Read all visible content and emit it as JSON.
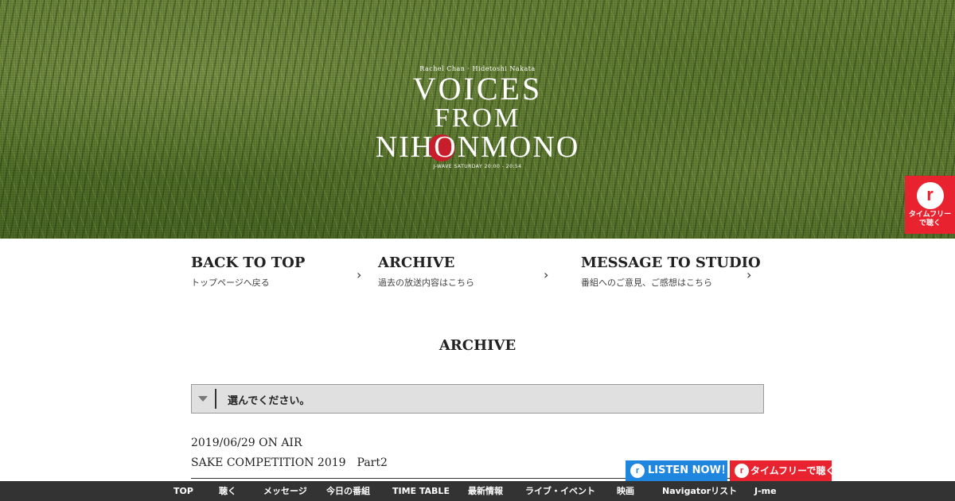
{
  "hero": {
    "logo_top": "Rachel Chan · Hidetoshi Nakata",
    "logo_line1": "VOICES",
    "logo_line2": "FROM",
    "logo_line3": "NIHONMONO",
    "logo_sub": "J-WAVE SATURDAY 20:00 - 20:54",
    "sun_color": "#c81e2c"
  },
  "radiko_side": {
    "icon": "radiko-r-icon",
    "label_line1": "タイムフリー",
    "label_line2": "で聴く"
  },
  "nav_links": [
    {
      "title": "BACK TO TOP",
      "sub": "トップページへ戻る"
    },
    {
      "title": "ARCHIVE",
      "sub": "過去の放送内容はこちら"
    },
    {
      "title": "MESSAGE TO STUDIO",
      "sub": "番組へのご意見、ご感想はこちら"
    }
  ],
  "archive_heading": "ARCHIVE",
  "select": {
    "selected": "選んでください。"
  },
  "entry": {
    "date": "2019/06/29 ON AIR",
    "title": "SAKE COMPETITION 2019　Part2"
  },
  "buttons": {
    "listen_now": "LISTEN NOW！",
    "timefree": "タイムフリーで聴く"
  },
  "bottom_nav": [
    "TOP",
    "聴く",
    "メッセージ",
    "今日の番組",
    "TIME TABLE",
    "最新情報",
    "ライブ・イベント",
    "映画",
    "Navigatorリスト",
    "J-me"
  ],
  "colors": {
    "radiko_red": "#e8232f",
    "listen_blue": "#1f86e0",
    "nav_bg": "#333333"
  }
}
